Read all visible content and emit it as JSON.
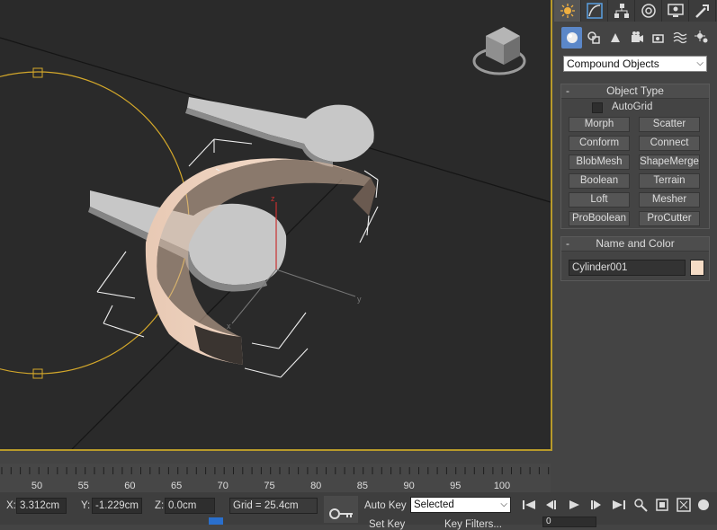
{
  "command_panel": {
    "tabs": [
      "create-tab",
      "modify-tab",
      "hierarchy-tab",
      "motion-tab",
      "display-tab",
      "utilities-tab"
    ],
    "subtabs": [
      "geometry-icon",
      "shapes-icon",
      "lights-icon",
      "cameras-icon",
      "helpers-icon",
      "spacewarps-icon",
      "systems-icon"
    ],
    "category": "Compound Objects",
    "object_type": {
      "title": "Object Type",
      "collapse": "-",
      "autogrid_label": "AutoGrid",
      "buttons": [
        "Morph",
        "Scatter",
        "Conform",
        "Connect",
        "BlobMesh",
        "ShapeMerge",
        "Boolean",
        "Terrain",
        "Loft",
        "Mesher",
        "ProBoolean",
        "ProCutter"
      ]
    },
    "name_color": {
      "title": "Name and Color",
      "collapse": "-",
      "name": "Cylinder001",
      "color": "#f5dcc6"
    }
  },
  "viewport": {
    "accent": "#b89a2a",
    "axis_labels": {
      "x": "x",
      "y": "y",
      "z": "z"
    }
  },
  "timeline": {
    "ticks": [
      "50",
      "55",
      "60",
      "65",
      "70",
      "75",
      "80",
      "85",
      "90",
      "95",
      "100"
    ]
  },
  "status_bar": {
    "x_label": "X:",
    "x_value": "3.312cm",
    "y_label": "Y:",
    "y_value": "-1.229cm",
    "z_label": "Z:",
    "z_value": "0.0cm",
    "grid": "Grid = 25.4cm",
    "auto_key": "Auto Key",
    "set_key": "Set Key",
    "selected": "Selected",
    "key_filters": "Key Filters...",
    "frame": "0"
  }
}
